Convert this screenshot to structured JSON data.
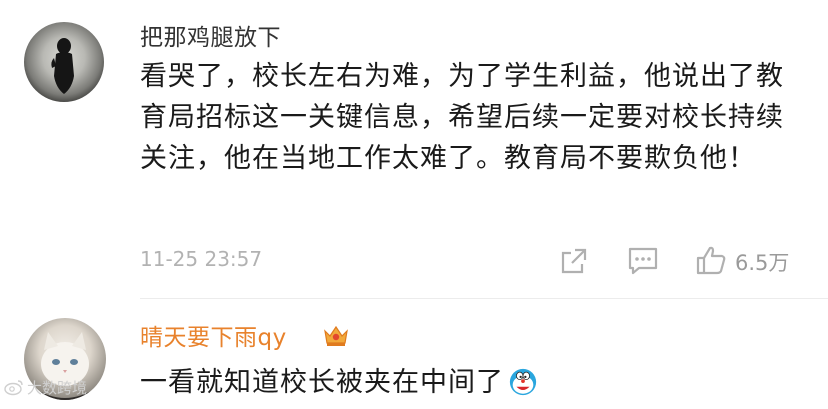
{
  "comments": [
    {
      "username": "把那鸡腿放下",
      "text": "看哭了，校长左右为难，为了学生利益，他说出了教育局招标这一关键信息，希望后续一定要对校长持续关注，他在当地工作太难了。教育局不要欺负他！",
      "timestamp": "11-25 23:57",
      "likes": "6.5万",
      "actions": [
        "share-icon",
        "comment-icon",
        "like-icon"
      ]
    },
    {
      "username": "晴天要下雨qy",
      "badge": "crown-badge-icon",
      "text": "一看就知道校长被夹在中间了",
      "emoji": "doraemon-emoji-icon"
    }
  ],
  "watermark": "大数跨境",
  "colors": {
    "username_default": "#333333",
    "username_vip": "#e8822c",
    "meta_gray": "#b2b2b2"
  }
}
